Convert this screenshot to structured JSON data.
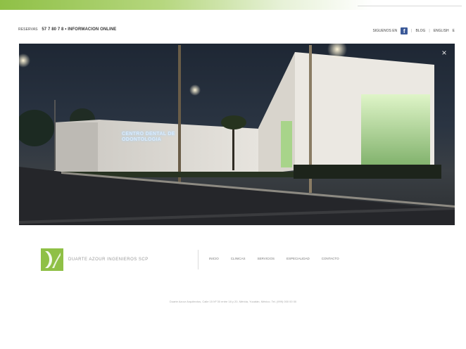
{
  "topbar": {
    "phone_prefix": "RESERVAS",
    "phone": "57 7 80 7 8 • INFORMACION ONLINE"
  },
  "toplinks": {
    "follow_label": "SIGUENOS EN",
    "blog_label": "BLOG",
    "lang_label": "ENGLISH",
    "close_label": "E"
  },
  "hero": {
    "close_label": "×",
    "sign_text": "CENTRO DENTAL DE ODONTOLOGIA"
  },
  "branding": {
    "name": "DUARTE AZOUR INGENIEROS SCP"
  },
  "nav": {
    "items": [
      "INICIO",
      "CLINICAS",
      "SERVICIOS",
      "ESPECIALIDAD",
      "CONTACTO"
    ]
  },
  "footer": {
    "address": "Duarte Azour Arquitectos, Calle 15 Nº 30 entre 18 y 20, Mérida, Yucatán, México. Tel. (999) 000 00 00"
  },
  "colors": {
    "brand_green": "#8fc046",
    "facebook_blue": "#3b5998"
  }
}
